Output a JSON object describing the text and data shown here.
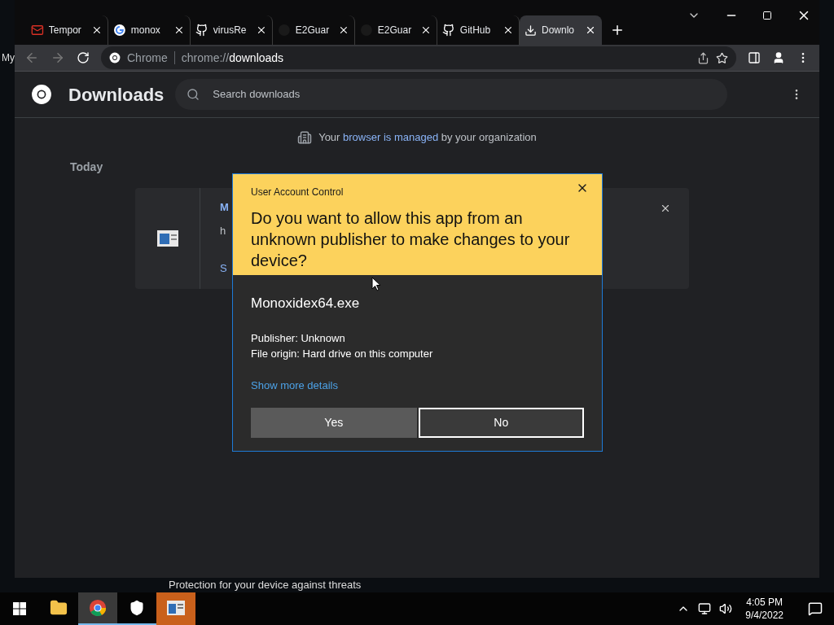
{
  "desktop": {
    "corner_text": "My"
  },
  "browser": {
    "tabs": [
      {
        "title": "Tempor",
        "kind": "mail",
        "selected": false
      },
      {
        "title": "monox",
        "kind": "google",
        "selected": false
      },
      {
        "title": "virusRe",
        "kind": "github",
        "selected": false
      },
      {
        "title": "E2Guar",
        "kind": "dark",
        "selected": false
      },
      {
        "title": "E2Guar",
        "kind": "dark",
        "selected": false
      },
      {
        "title": "GitHub",
        "kind": "github",
        "selected": false
      },
      {
        "title": "Downlo",
        "kind": "download",
        "selected": true
      }
    ],
    "omnibox": {
      "chip": "Chrome",
      "url_prefix": "chrome://",
      "url_host": "downloads"
    }
  },
  "downloads": {
    "title": "Downloads",
    "search": {
      "placeholder": "Search downloads"
    },
    "managed_notice": {
      "before": "Your",
      "link": "browser is managed",
      "after": "by your organization"
    },
    "section": "Today",
    "item": {
      "name": "M",
      "url": "h",
      "action": "S"
    }
  },
  "uac": {
    "title": "User Account Control",
    "question": "Do you want to allow this app from an unknown publisher to make changes to your device?",
    "program": "Monoxidex64.exe",
    "publisher": "Publisher: Unknown",
    "origin": "File origin: Hard drive on this computer",
    "details_link": "Show more details",
    "buttons": [
      {
        "label": "Yes",
        "focused": false
      },
      {
        "label": "No",
        "focused": true
      }
    ]
  },
  "notification_text": "Protection for your device against threats",
  "taskbar": {
    "apps": [
      {
        "kind": "explorer",
        "running": false,
        "focused": false,
        "flashing": false
      },
      {
        "kind": "chrome",
        "running": true,
        "focused": true,
        "flashing": false
      },
      {
        "kind": "security",
        "running": true,
        "focused": false,
        "flashing": false
      },
      {
        "kind": "installer",
        "running": false,
        "focused": false,
        "flashing": true
      }
    ],
    "time": "4:05 PM",
    "date": "9/4/2022"
  }
}
